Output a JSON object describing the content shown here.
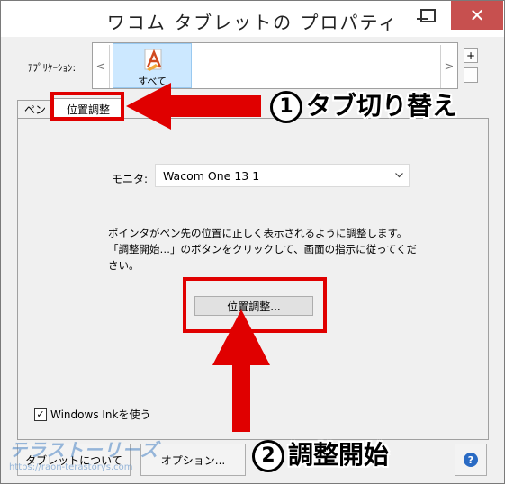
{
  "window": {
    "title": "ワコム タブレットの プロパティ",
    "close_glyph": "✕"
  },
  "applications": {
    "label": "ｱﾌﾟﾘｹｰｼｮﾝ:",
    "prev_glyph": "<",
    "next_glyph": ">",
    "selected_app": "すべて",
    "add_glyph": "+",
    "remove_glyph": "-"
  },
  "tabs": [
    {
      "label": "ペン"
    },
    {
      "label": "位置調整",
      "selected": true
    }
  ],
  "panel": {
    "monitor_label": "モニタ:",
    "monitor_value": "Wacom One 13 1",
    "description": "ポインタがペン先の位置に正しく表示されるように調整します。「調整開始…」のボタンをクリックして、画面の指示に従ってください。",
    "calibrate_button": "位置調整...",
    "windows_ink_label": "Windows Inkを使う",
    "windows_ink_checked": true,
    "check_glyph": "✓"
  },
  "footer": {
    "about_button": "タブレットについて",
    "options_button": "オプション...",
    "help_glyph": "?"
  },
  "annotations": {
    "step1_number": "1",
    "step1_text": "タブ切り替え",
    "step2_number": "2",
    "step2_text": "調整開始",
    "color": "#e00000"
  },
  "watermark": {
    "logo_text": "テラストーリーズ",
    "url": "https://raon-terastorys.com"
  }
}
